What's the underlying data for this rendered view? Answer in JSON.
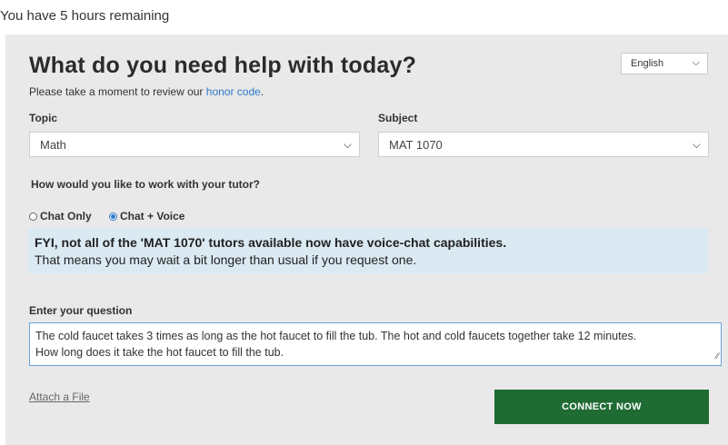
{
  "status": {
    "remaining": "You have 5 hours remaining"
  },
  "form": {
    "title": "What do you need help with today?",
    "language": "English",
    "honor_prefix": "Please take a moment to review our ",
    "honor_link": "honor code",
    "honor_suffix": ".",
    "topic_label": "Topic",
    "topic_value": "Math",
    "subject_label": "Subject",
    "subject_value": "MAT 1070",
    "work_label": "How would you like to work with your tutor?",
    "options": [
      "Chat Only",
      "Chat + Voice"
    ],
    "selected_option": "Chat + Voice",
    "fyi_line1": "FYI, not all of the 'MAT 1070' tutors available now have voice-chat capabilities.",
    "fyi_line2": "That means you may wait a bit longer than usual if you request one.",
    "question_label": "Enter your question",
    "question_line1": "The cold faucet takes 3 times as long as the hot faucet to fill the tub. The hot and cold faucets together take 12 minutes.",
    "question_line2": "How long does it take the hot faucet to fill the tub.",
    "attach_label": "Attach a File",
    "connect_label": "CONNECT NOW"
  },
  "icons": {
    "dropdown": "chevron-down-icon",
    "resize": "resize-grip-icon"
  },
  "colors": {
    "accent": "#2e77c9",
    "connect": "#1f6b34",
    "panel": "#e9e9e9",
    "notice": "#dbe9f3"
  }
}
